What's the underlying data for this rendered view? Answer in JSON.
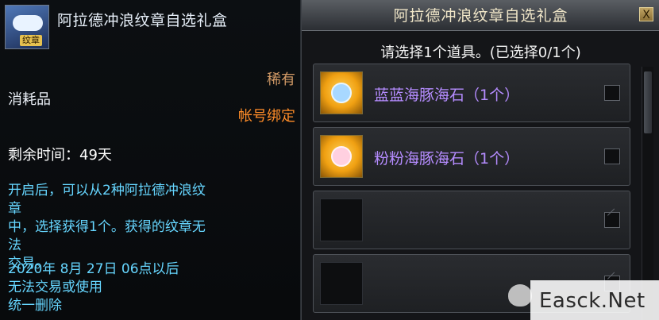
{
  "tooltip": {
    "icon_badge": "纹章",
    "title": "阿拉德冲浪纹章自选礼盒",
    "rarity": "稀有",
    "type": "消耗品",
    "bind": "帐号绑定",
    "time_remaining": "剩余时间：49天",
    "description": [
      "开启后，可以从2种阿拉德冲浪纹章",
      "中，选择获得1个。获得的纹章无法",
      "交易。"
    ],
    "trade_limit": [
      "2020年 8月 27日 06点以后",
      "无法交易或使用",
      "统一删除"
    ]
  },
  "window": {
    "title": "阿拉德冲浪纹章自选礼盒",
    "close_label": "X",
    "prompt": "请选择1个道具。(已选择0/1个)",
    "items": [
      {
        "name": "蓝蓝海豚海石（1个）",
        "checked": false
      },
      {
        "name": "粉粉海豚海石（1个）",
        "checked": false
      },
      {
        "name": "",
        "checked": false,
        "disabled": true
      },
      {
        "name": "",
        "checked": false,
        "disabled": true
      }
    ]
  },
  "watermark": {
    "text": "Easck.Net"
  },
  "colors": {
    "rarity": "#d29a66",
    "bind": "#ff8c28",
    "desc": "#66d6ff",
    "item_name": "#b58cff",
    "title": "#f0e6c8"
  }
}
